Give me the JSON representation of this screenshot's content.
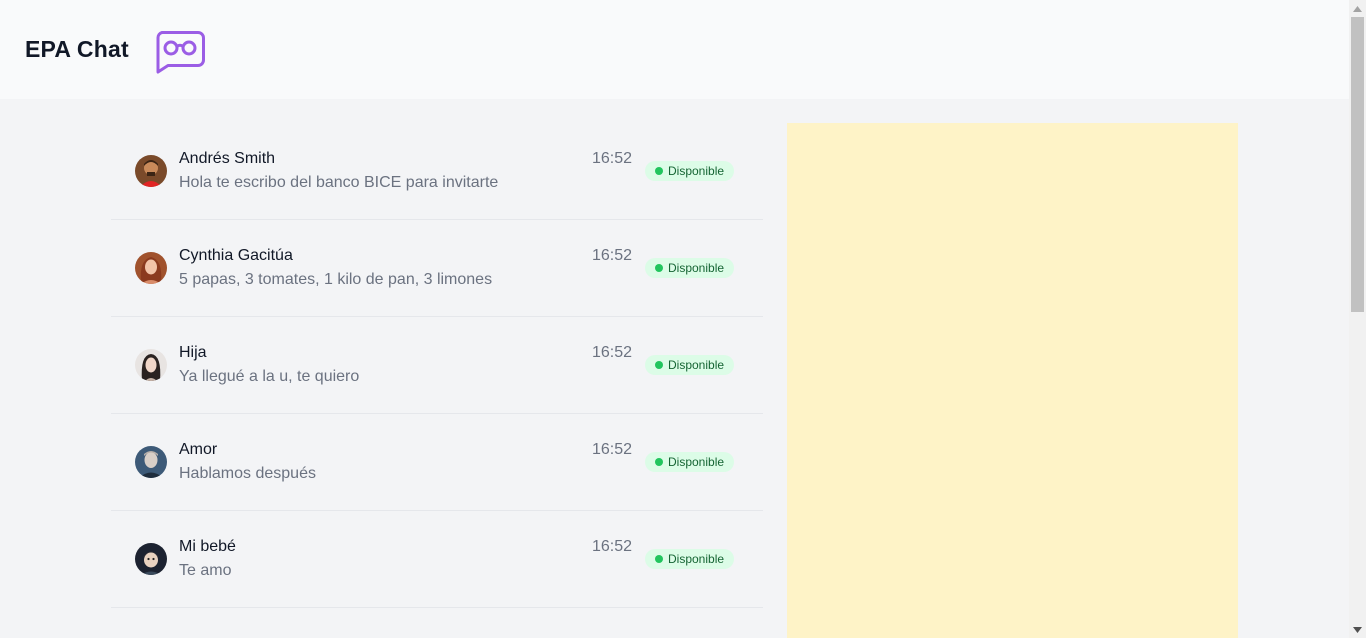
{
  "app": {
    "title": "EPA Chat",
    "logo_icon": "chat-bubble-glasses-icon",
    "accent_color": "#9b5de5"
  },
  "chats": [
    {
      "name": "Andrés Smith",
      "message": "Hola te escribo del banco BICE para invitarte",
      "time": "16:52",
      "status": "Disponible"
    },
    {
      "name": "Cynthia Gacitúa",
      "message": "5 papas, 3 tomates, 1 kilo de pan, 3 limones",
      "time": "16:52",
      "status": "Disponible"
    },
    {
      "name": "Hija",
      "message": "Ya llegué a la u, te quiero",
      "time": "16:52",
      "status": "Disponible"
    },
    {
      "name": "Amor",
      "message": "Hablamos después",
      "time": "16:52",
      "status": "Disponible"
    },
    {
      "name": "Mi bebé",
      "message": "Te amo",
      "time": "16:52",
      "status": "Disponible"
    }
  ],
  "colors": {
    "status_bg": "#dcfce7",
    "status_dot": "#22c55e",
    "panel_bg": "#fef3c7"
  }
}
